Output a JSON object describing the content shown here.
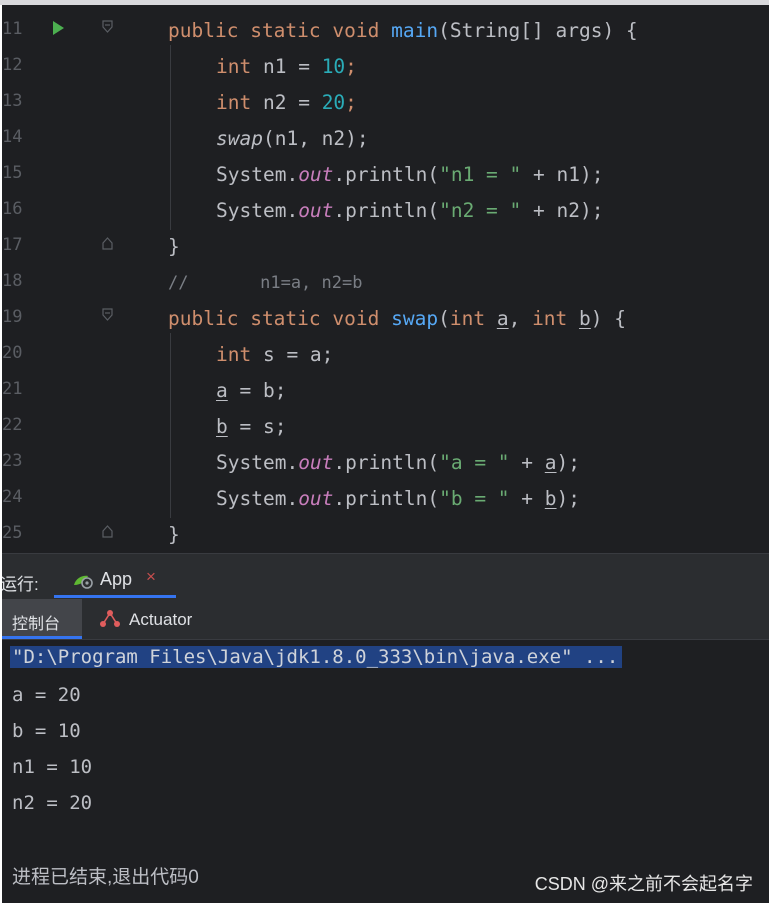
{
  "top_caption": "…",
  "editor": {
    "lines": [
      {
        "num": "11",
        "has_run": true,
        "fold": "top"
      },
      {
        "num": "12"
      },
      {
        "num": "13"
      },
      {
        "num": "14"
      },
      {
        "num": "15"
      },
      {
        "num": "16"
      },
      {
        "num": "17",
        "fold": "bottom"
      },
      {
        "num": "18"
      },
      {
        "num": "19",
        "fold": "top"
      },
      {
        "num": "20"
      },
      {
        "num": "21"
      },
      {
        "num": "22"
      },
      {
        "num": "23"
      },
      {
        "num": "24"
      },
      {
        "num": "25",
        "fold": "bottom"
      }
    ],
    "tokens": {
      "public": "public",
      "static": "static",
      "void": "void",
      "main": "main",
      "main_params": "(String[] args) {",
      "int": "int",
      "n1_decl": " n1 = ",
      "ten": "10",
      "n2_decl": " n2 = ",
      "twenty": "20",
      "semi": ";",
      "swap_call": "swap",
      "swap_args": "(n1, n2);",
      "system": "System.",
      "out": "out",
      "println": ".println(",
      "str_n1": "\"n1 = \"",
      "plus_n1": " + n1);",
      "str_n2": "\"n2 = \"",
      "plus_n2": " + n2);",
      "close_brace": "}",
      "comment": "//       n1=a, n2=b",
      "swap_name": "swap",
      "paren_open": "(",
      "a": "a",
      "comma": ", ",
      "b": "b",
      "paren_close_brace": ") {",
      "s_decl": " s = a;",
      "eq_b": " = b;",
      "eq_s": " = s;",
      "str_a": "\"a = \"",
      "str_b": "\"b = \"",
      "plus": " + ",
      "close_paren_semi": ");"
    }
  },
  "run_panel": {
    "label": "运行:",
    "tab_label": "App",
    "tab_close": "×",
    "console_tab": "控制台",
    "actuator_tab": "Actuator"
  },
  "console": {
    "command": "\"D:\\Program Files\\Java\\jdk1.8.0_333\\bin\\java.exe\" ...",
    "output": [
      "a = 20",
      "b = 10",
      "n1 = 10",
      "n2 = 20"
    ],
    "exit_message": "进程已结束,退出代码0"
  },
  "watermark": "CSDN @来之前不会起名字",
  "colors": {
    "keyword": "#cf8e6d",
    "number": "#2aacb8",
    "string": "#6aab73",
    "function": "#56a8f5",
    "static_field": "#c77dbb",
    "selection": "#214283",
    "accent": "#3574f0"
  }
}
